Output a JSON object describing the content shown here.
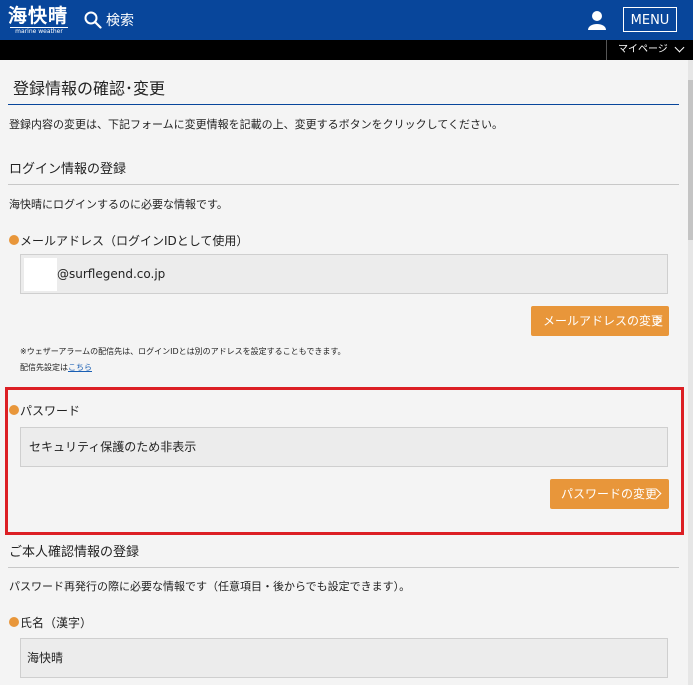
{
  "header": {
    "logo_text": "海快晴",
    "logo_subtext": "marine weather",
    "search_label": "検索",
    "menu_label": "MENU"
  },
  "subnav": {
    "mypage_label": "マイページ"
  },
  "page": {
    "title": "登録情報の確認･変更",
    "description": "登録内容の変更は、下記フォームに変更情報を記載の上、変更するボタンをクリックしてください。"
  },
  "login_section": {
    "title": "ログイン情報の登録",
    "description": "海快晴にログインするのに必要な情報です。",
    "email_label": "メールアドレス（ログインIDとして使用）",
    "email_value": "@surflegend.co.jp",
    "email_change_button": "メールアドレスの変更",
    "alarm_note": "※ウェザーアラームの配信先は、ログインIDとは別のアドレスを設定することもできます。",
    "alarm_link_prefix": "配信先設定は",
    "alarm_link_text": "こちら"
  },
  "password_section": {
    "label": "パスワード",
    "value": "セキュリティ保護のため非表示",
    "change_button": "パスワードの変更"
  },
  "identity_section": {
    "title": "ご本人確認情報の登録",
    "description": "パスワード再発行の際に必要な情報です（任意項目・後からでも設定できます）。",
    "name_label": "氏名（漢字）",
    "name_value": "海快晴"
  },
  "colors": {
    "header_bg": "#08469b",
    "accent_orange": "#e8963a",
    "highlight_red": "#dc1f24"
  },
  "icons": [
    "search-icon",
    "user-icon",
    "chevron-down-icon",
    "chevron-right-icon",
    "bullet-dot-icon"
  ]
}
